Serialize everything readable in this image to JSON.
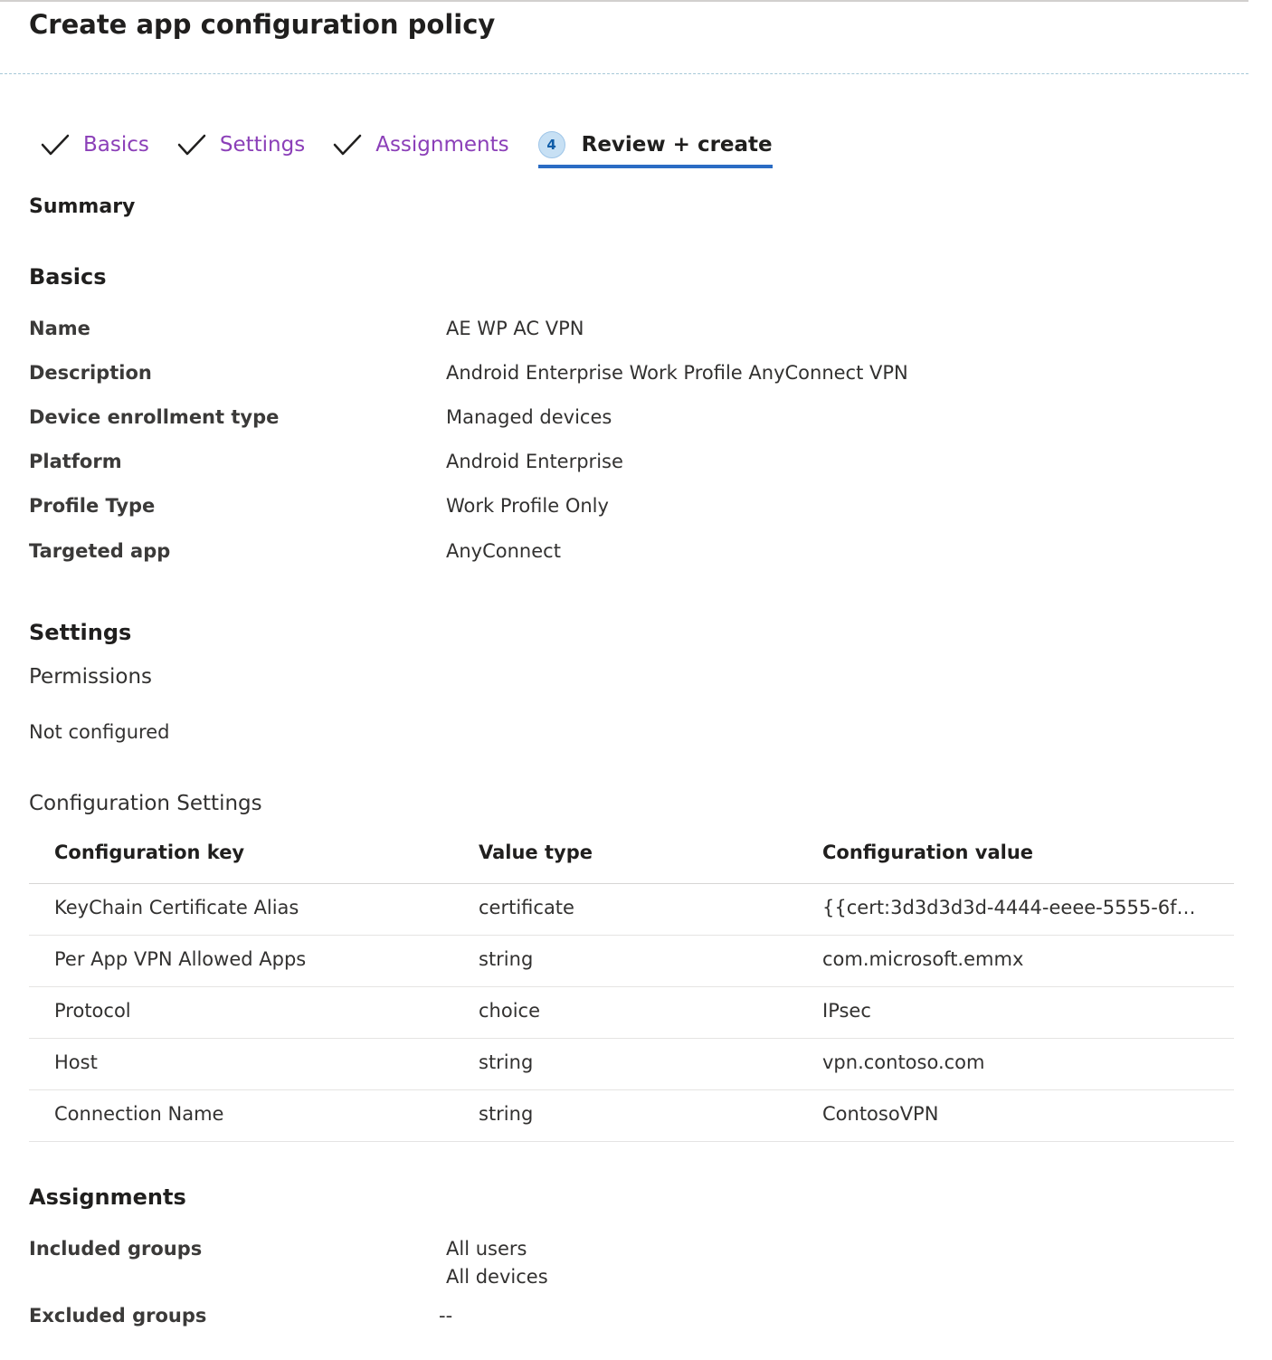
{
  "page": {
    "title": "Create app configuration policy"
  },
  "wizard": {
    "steps": [
      {
        "label": "Basics",
        "state": "complete"
      },
      {
        "label": "Settings",
        "state": "complete"
      },
      {
        "label": "Assignments",
        "state": "complete"
      },
      {
        "label": "Review + create",
        "state": "active",
        "number": "4"
      }
    ]
  },
  "summary": {
    "label": "Summary"
  },
  "basics": {
    "heading": "Basics",
    "rows": [
      {
        "key": "Name",
        "value": "AE WP AC VPN"
      },
      {
        "key": "Description",
        "value": "Android Enterprise Work Profile AnyConnect VPN"
      },
      {
        "key": "Device enrollment type",
        "value": "Managed devices"
      },
      {
        "key": "Platform",
        "value": "Android Enterprise"
      },
      {
        "key": "Profile Type",
        "value": "Work Profile Only"
      },
      {
        "key": "Targeted app",
        "value": "AnyConnect"
      }
    ]
  },
  "settings": {
    "heading": "Settings",
    "permissions_label": "Permissions",
    "permissions_value": "Not configured",
    "config_label": "Configuration Settings",
    "table": {
      "columns": [
        "Configuration key",
        "Value type",
        "Configuration value"
      ],
      "rows": [
        [
          "KeyChain Certificate Alias",
          "certificate",
          "{{cert:3d3d3d3d-4444-eeee-5555-6f6f..."
        ],
        [
          "Per App VPN Allowed Apps",
          "string",
          "com.microsoft.emmx"
        ],
        [
          "Protocol",
          "choice",
          "IPsec"
        ],
        [
          "Host",
          "string",
          "vpn.contoso.com"
        ],
        [
          "Connection Name",
          "string",
          "ContosoVPN"
        ]
      ]
    }
  },
  "assignments": {
    "heading": "Assignments",
    "included_label": "Included groups",
    "included_values": [
      "All users",
      "All devices"
    ],
    "excluded_label": "Excluded groups",
    "excluded_value": "--"
  },
  "colors": {
    "accent": "#2b6cc4",
    "visited_link": "#8b3fb8",
    "step_badge_bg": "#c7e0f4"
  }
}
